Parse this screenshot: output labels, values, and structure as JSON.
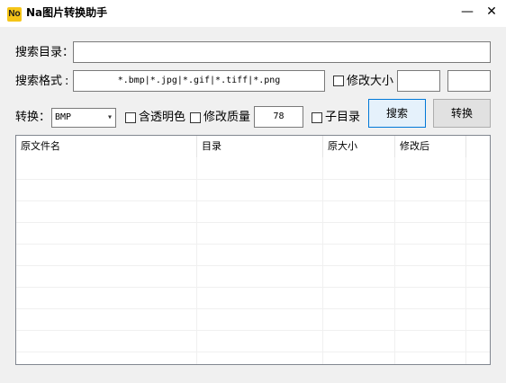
{
  "window": {
    "icon_text": "No",
    "title": "Na图片转换助手",
    "minimize": "—",
    "close": "✕"
  },
  "search": {
    "dir_label": "搜索目录：",
    "dir_value": "",
    "format_label": "搜索格式",
    "format_value": "*.bmp|*.jpg|*.gif|*.tiff|*.png"
  },
  "resize": {
    "label": "修改大小",
    "checked": false,
    "width_value": "",
    "height_value": ""
  },
  "convert": {
    "label": "转换：",
    "format_selected": "BMP",
    "transparent_label": "含透明色",
    "quality_label": "修改质量",
    "quality_value": "78",
    "subdir_label": "子目录"
  },
  "buttons": {
    "search": "搜索",
    "convert": "转换"
  },
  "table": {
    "columns": [
      "原文件名",
      "目录",
      "原大小",
      "修改后"
    ],
    "rows": []
  }
}
